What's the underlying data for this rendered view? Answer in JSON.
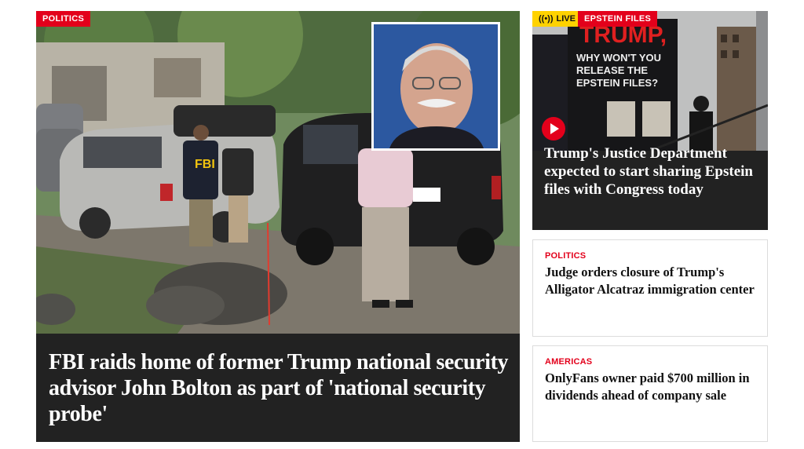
{
  "hero": {
    "category": "POLITICS",
    "headline": "FBI raids home of former Trump national security advisor John Bolton as part of 'national security probe'",
    "vest_text": "FBI"
  },
  "side_top": {
    "live_label": "LIVE",
    "category": "EPSTEIN FILES",
    "billboard_line1": "TRUMP,",
    "billboard_line2": "WHY WON'T YOU",
    "billboard_line3": "RELEASE THE",
    "billboard_line4": "EPSTEIN FILES?",
    "headline": "Trump's Justice Department expected to start sharing Epstein files with Congress today",
    "icons": [
      "live-broadcast-icon",
      "play-icon"
    ]
  },
  "card1": {
    "category": "POLITICS",
    "headline": "Judge orders closure of Trump's Alligator Alcatraz immigration center"
  },
  "card2": {
    "category": "AMERICAS",
    "headline": "OnlyFans owner paid $700 million in dividends ahead of company sale"
  },
  "colors": {
    "accent_red": "#e3001b",
    "live_yellow": "#ffd200",
    "dark_caption": "#222222"
  }
}
